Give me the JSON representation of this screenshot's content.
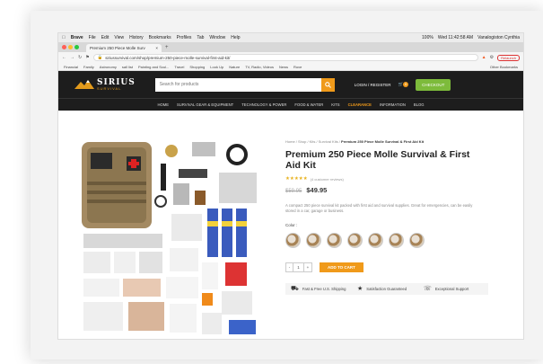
{
  "menubar": {
    "items": [
      "Brave",
      "File",
      "Edit",
      "View",
      "History",
      "Bookmarks",
      "Profiles",
      "Tab",
      "Window",
      "Help"
    ],
    "right": [
      "100%",
      "Wed 11:42:58 AM",
      "Vanalogiston Cynthia"
    ]
  },
  "tab": {
    "title": "Premium 250 Piece Molle Surv",
    "close": "×"
  },
  "address": {
    "url": "siriussurvival.com/shop/premium-250-piece-molle-survival-first-aid-kit/",
    "relaunch": "Relaunch"
  },
  "bookmarks": [
    "Financial",
    "Family",
    "Astronomy",
    "sall list",
    "Painting and Scul...",
    "Travel",
    "Shopping",
    "Look Up",
    "Nature",
    "TV, Radio, Videos",
    "News",
    "Rove",
    "Other Bookmarks"
  ],
  "site": {
    "logo_title": "SIRIUS",
    "logo_sub": "SURVIVAL",
    "search_placeholder": "Search for products",
    "login": "LOGIN / REGISTER",
    "cart_count": "0",
    "checkout": "CHECKOUT"
  },
  "nav": [
    "HOME",
    "SURVIVAL GEAR & EQUIPMENT",
    "TECHNOLOGY & POWER",
    "FOOD & WATER",
    "KITS",
    "CLEARANCE",
    "INFORMATION",
    "BLOG"
  ],
  "product": {
    "breadcrumb": "Home / Shop / Kits / Survival Kits / ",
    "breadcrumb_current": "Premium 250 Piece Molle Survival & First Aid Kit",
    "title": "Premium 250 Piece Molle Survival & First Aid Kit",
    "stars": "★★★★★",
    "reviews": "(4 customer reviews)",
    "old_price": "$59.95",
    "price": "$49.95",
    "description": "A compact 250 piece survival kit packed with first aid and survival supplies. Great for emergencies, can be easily stored in a car, garage or business.",
    "color_label": "Color :",
    "qty": "1",
    "qty_minus": "-",
    "qty_plus": "+",
    "add_to_cart": "ADD TO CART",
    "perks": [
      {
        "icon": "truck-icon",
        "text": "Fast & Free U.S. Shipping"
      },
      {
        "icon": "badge-icon",
        "text": "Satisfaction Guaranteed"
      },
      {
        "icon": "support-icon",
        "text": "Exceptional Support"
      }
    ]
  },
  "colors": {
    "accent": "#f09a1a",
    "header": "#1d1d1d",
    "checkout": "#7dbb3b"
  }
}
